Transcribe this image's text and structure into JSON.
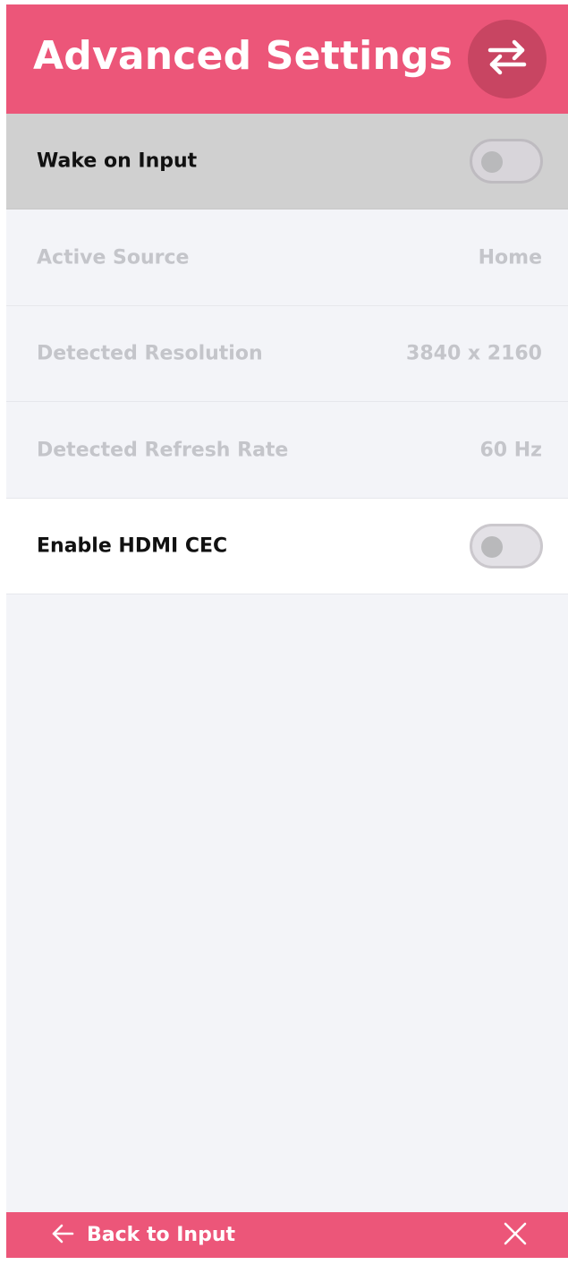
{
  "header": {
    "title": "Advanced Settings",
    "swap_icon": "swap-arrows-icon"
  },
  "settings": {
    "wake_on_input": {
      "label": "Wake on Input",
      "enabled": false
    },
    "active_source": {
      "label": "Active Source",
      "value": "Home"
    },
    "detected_resolution": {
      "label": "Detected Resolution",
      "value": "3840 x 2160"
    },
    "detected_refresh_rate": {
      "label": "Detected Refresh Rate",
      "value": "60 Hz"
    },
    "enable_hdmi_cec": {
      "label": "Enable HDMI CEC",
      "enabled": false
    }
  },
  "footer": {
    "back_label": "Back to Input",
    "back_icon": "arrow-left-icon",
    "close_icon": "close-icon"
  },
  "colors": {
    "accent": "#ec5679",
    "accent_dark": "#c84562",
    "background": "#f3f4f8",
    "highlight_row": "#d0d0d0",
    "disabled_text": "#c4c5ca"
  }
}
